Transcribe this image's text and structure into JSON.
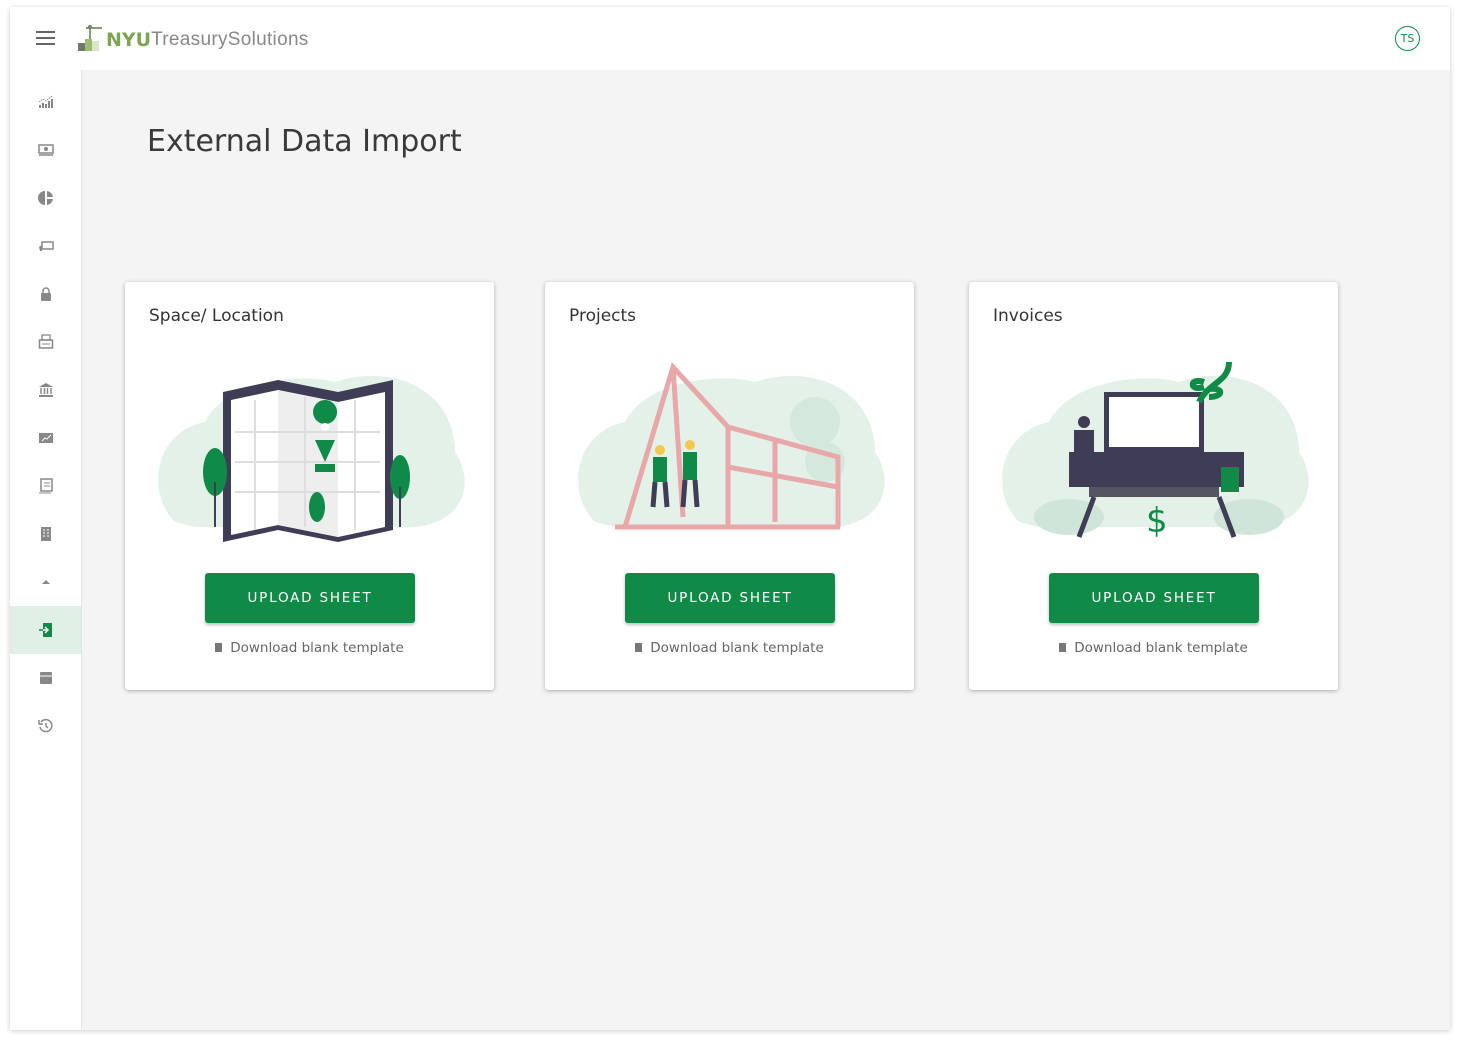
{
  "header": {
    "logo_bold": "NYU",
    "logo_light": "TreasurySolutions",
    "avatar_initials": "TS",
    "menu_icon": "hamburger-icon"
  },
  "sidebar": {
    "items": [
      {
        "icon": "analytics-icon"
      },
      {
        "icon": "cash-icon"
      },
      {
        "icon": "pie-chart-icon"
      },
      {
        "icon": "payment-icon"
      },
      {
        "icon": "lock-icon"
      },
      {
        "icon": "printer-icon"
      },
      {
        "icon": "bank-icon"
      },
      {
        "icon": "chart-image-icon"
      },
      {
        "icon": "list-document-icon"
      },
      {
        "icon": "building-icon"
      },
      {
        "icon": "collapse-up-icon"
      },
      {
        "icon": "import-icon",
        "active": true
      },
      {
        "icon": "archive-icon"
      },
      {
        "icon": "history-icon"
      }
    ]
  },
  "main": {
    "title": "External Data Import",
    "cards": [
      {
        "title": "Space/ Location",
        "button": "UPLOAD SHEET",
        "link": "Download blank template",
        "illustration": "map-icon"
      },
      {
        "title": "Projects",
        "button": "UPLOAD SHEET",
        "link": "Download blank template",
        "illustration": "construction-icon"
      },
      {
        "title": "Invoices",
        "button": "UPLOAD SHEET",
        "link": "Download blank template",
        "illustration": "invoice-icon"
      }
    ]
  },
  "colors": {
    "accent": "#108a47",
    "logo_green": "#7ca452",
    "active_bg": "#e0f0e7"
  }
}
